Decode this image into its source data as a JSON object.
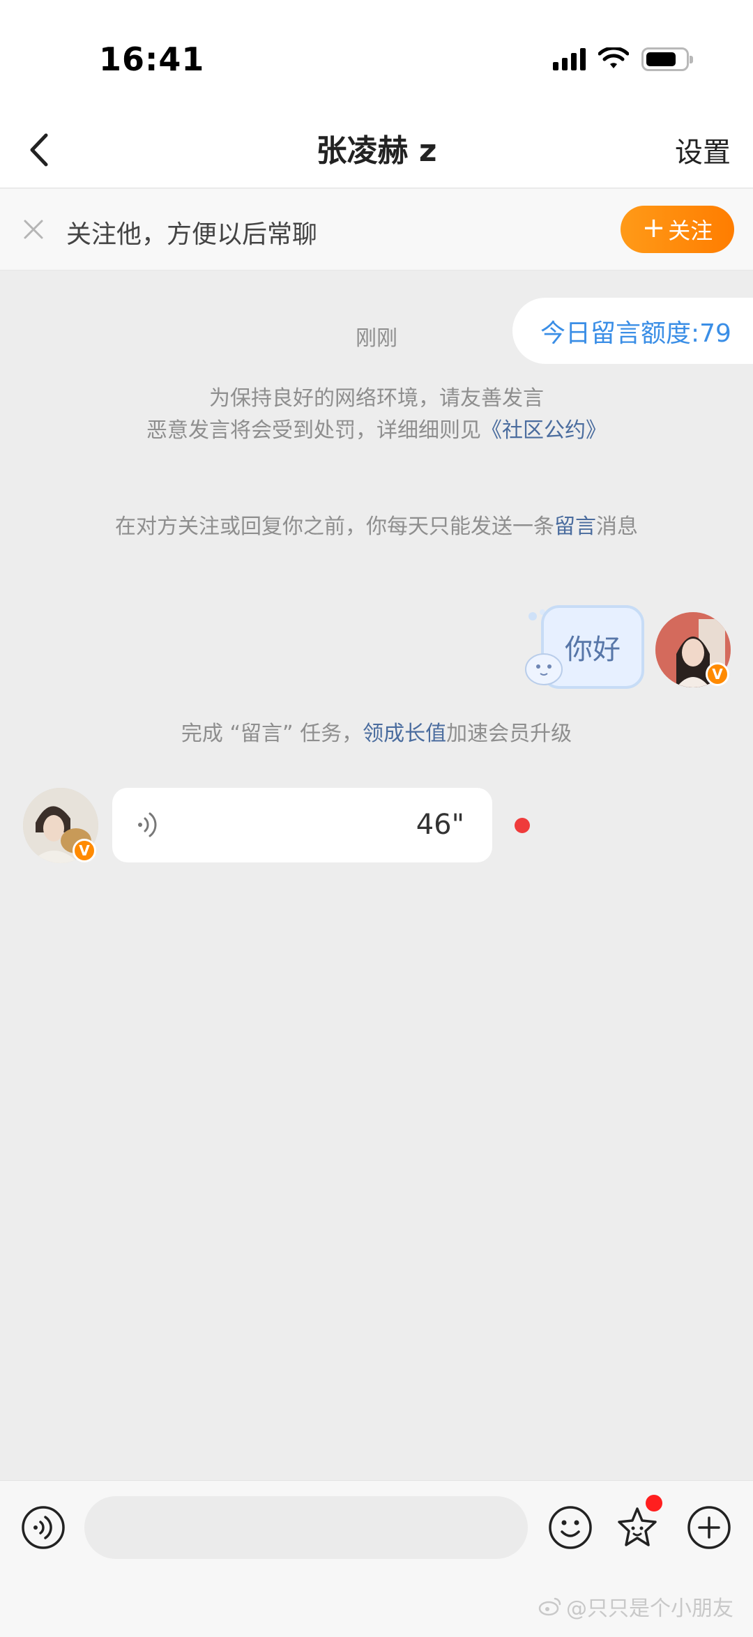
{
  "status_bar": {
    "time": "16:41"
  },
  "nav": {
    "title": "张凌赫 z",
    "settings_label": "设置"
  },
  "follow_banner": {
    "text": "关注他，方便以后常聊",
    "button_label": "关注",
    "button_color": "#ff8a00"
  },
  "chat": {
    "quota": "今日留言额度:79",
    "timestamp": "刚刚",
    "notice_line1": "为保持良好的网络环境，请友善发言",
    "notice_line2_prefix": "恶意发言将会受到处罚，详细细则见",
    "notice_line2_link": "《社区公约》",
    "rule_prefix": "在对方关注或回复你之前，你每天只能发送一条",
    "rule_link": "留言",
    "rule_suffix": "消息",
    "my_message": "你好",
    "task_prefix": "完成 “留言” 任务，",
    "task_link": "领成长值",
    "task_suffix": "加速会员升级",
    "voice_duration": "46\"",
    "verified_badge": "V"
  },
  "input_bar": {
    "voice_icon": "voice-input-icon",
    "emoji_icon": "emoji-icon",
    "star_icon": "star-face-icon",
    "plus_icon": "plus-circle-icon"
  },
  "watermark": "@只只是个小朋友",
  "colors": {
    "accent_orange": "#ff8a00",
    "link_blue": "#4a6c9e",
    "quota_blue": "#3a8ee6",
    "unread_red": "#ef3b3b"
  }
}
